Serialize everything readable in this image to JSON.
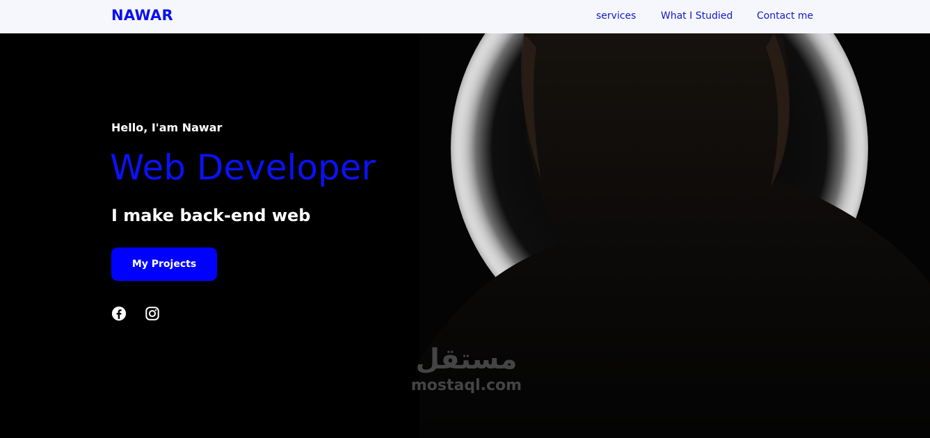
{
  "nav": {
    "brand": "NAWAR",
    "links": [
      {
        "label": "services"
      },
      {
        "label": "What I Studied"
      },
      {
        "label": "Contact me"
      }
    ]
  },
  "hero": {
    "greeting": "Hello, I'am Nawar",
    "role": "Web Developer",
    "tagline": "I make back-end web",
    "cta_label": "My Projects",
    "social": [
      {
        "icon": "facebook-icon"
      },
      {
        "icon": "instagram-icon"
      }
    ]
  },
  "watermark": {
    "arabic": "مستقل",
    "latin": "mostaql.com"
  },
  "colors": {
    "accent": "#0000ff",
    "nav_bg": "#f6f7fd",
    "page_bg": "#000000"
  }
}
